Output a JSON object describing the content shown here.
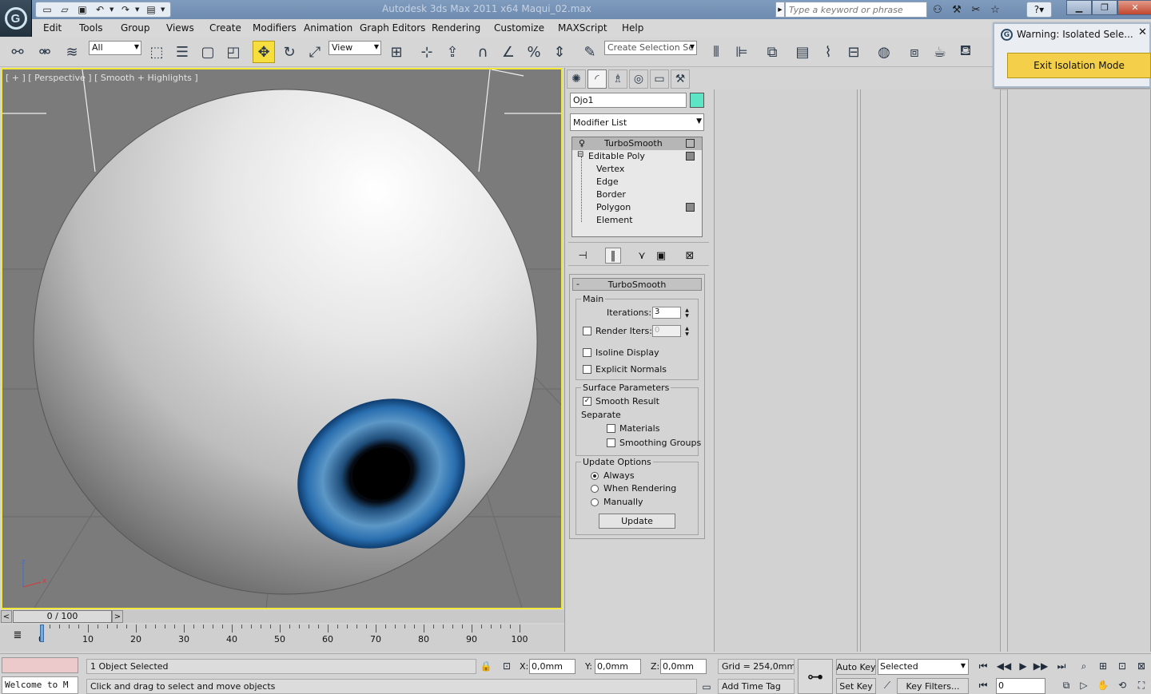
{
  "titlebar": {
    "title": "Autodesk 3ds Max  2011 x64      Maqui_02.max",
    "search_placeholder": "Type a keyword or phrase",
    "app_logo_letter": "G"
  },
  "menu": [
    "Edit",
    "Tools",
    "Group",
    "Views",
    "Create",
    "Modifiers",
    "Animation",
    "Graph Editors",
    "Rendering",
    "Customize",
    "MAXScript",
    "Help"
  ],
  "toolbar": {
    "filter_value": "All",
    "refcoord_value": "View",
    "selection_set_placeholder": "Create Selection Se"
  },
  "warning": {
    "title": "Warning: Isolated Sele...",
    "close": "✕",
    "button": "Exit Isolation Mode"
  },
  "viewport": {
    "label": "[ + ] [ Perspective ] [ Smooth + Highlights ]",
    "axis_z": "z",
    "axis_x": "x"
  },
  "command_panel": {
    "object_name": "Ojo1",
    "object_color": "#5ce6c6",
    "modifier_list": "Modifier List",
    "stack": [
      {
        "label": "TurboSmooth",
        "selected": true
      },
      {
        "label": "Editable Poly",
        "selected": false
      },
      {
        "label": "Vertex"
      },
      {
        "label": "Edge"
      },
      {
        "label": "Border"
      },
      {
        "label": "Polygon"
      },
      {
        "label": "Element"
      }
    ],
    "rollout": {
      "title": "TurboSmooth",
      "collapse": "-",
      "main_group": "Main",
      "iterations_label": "Iterations:",
      "iterations_value": "3",
      "render_iters_label": "Render Iters:",
      "render_iters_value": "0",
      "isoline_label": "Isoline Display",
      "explicit_normals_label": "Explicit Normals",
      "surface_group": "Surface Parameters",
      "smooth_result_label": "Smooth Result",
      "separate_label": "Separate",
      "materials_label": "Materials",
      "smoothing_groups_label": "Smoothing Groups",
      "update_group": "Update Options",
      "always_label": "Always",
      "when_rendering_label": "When Rendering",
      "manually_label": "Manually",
      "update_button": "Update"
    }
  },
  "timeline": {
    "position": "0 / 100",
    "ticks": [
      "0",
      "10",
      "20",
      "30",
      "40",
      "50",
      "60",
      "70",
      "80",
      "90",
      "100"
    ]
  },
  "status": {
    "maxscript_text": "Welcome to M",
    "selection": "1 Object Selected",
    "prompt": "Click and drag to select and move objects",
    "x_label": "X:",
    "x_value": "0,0mm",
    "y_label": "Y:",
    "y_value": "0,0mm",
    "z_label": "Z:",
    "z_value": "0,0mm",
    "grid": "Grid = 254,0mm",
    "add_time_tag": "Add Time Tag",
    "auto_key": "Auto Key",
    "set_key": "Set Key",
    "key_mode_value": "Selected",
    "key_filters": "Key Filters...",
    "frame_value": "0"
  },
  "colors": {
    "viewport_border": "#f2e83a",
    "warning_button": "#f4d04a",
    "iris": "#2a6fb0"
  }
}
